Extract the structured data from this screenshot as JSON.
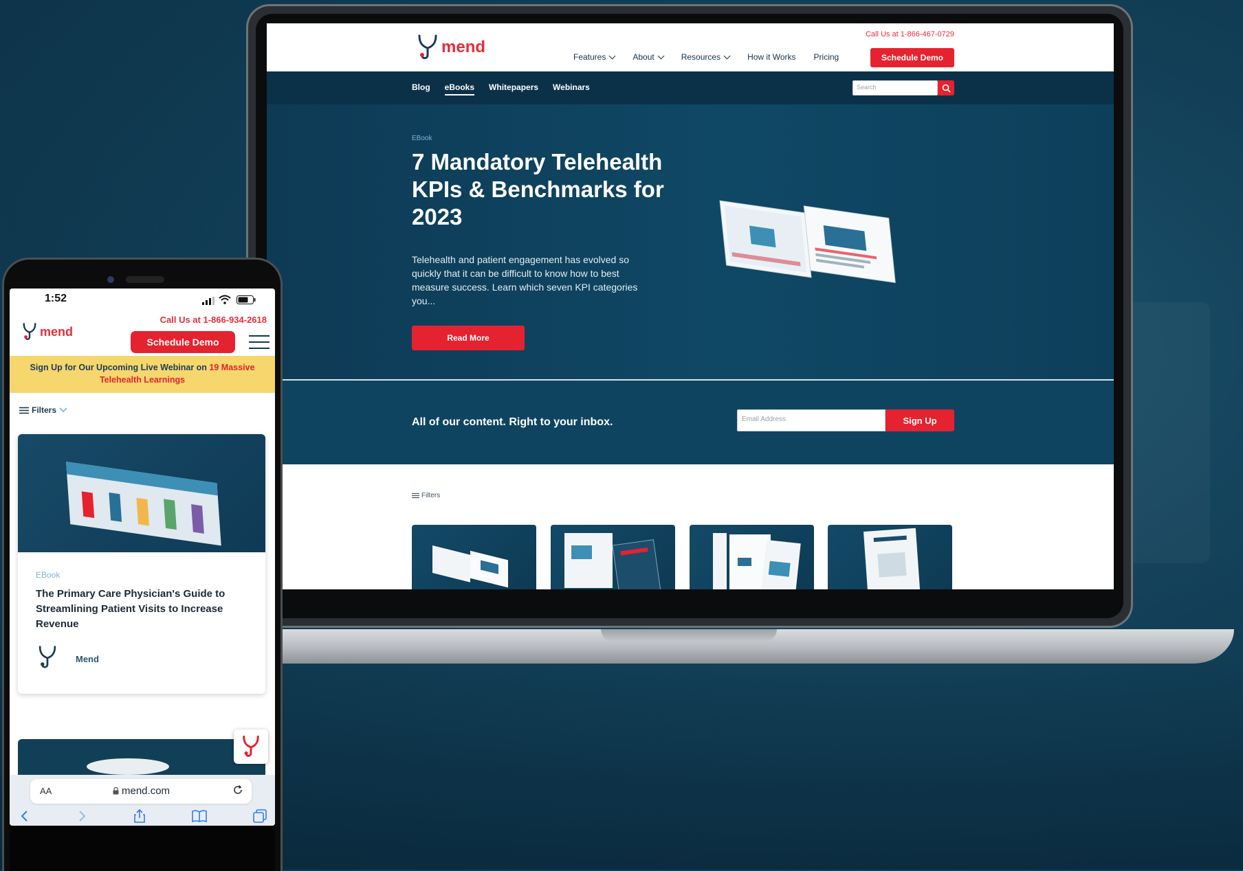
{
  "laptop": {
    "brand": "mend",
    "call_us": "Call Us at 1-866-467-0729",
    "nav": [
      {
        "label": "Features",
        "dropdown": true
      },
      {
        "label": "About",
        "dropdown": true
      },
      {
        "label": "Resources",
        "dropdown": true
      },
      {
        "label": "How it Works",
        "dropdown": false
      },
      {
        "label": "Pricing",
        "dropdown": false
      }
    ],
    "schedule_demo": "Schedule Demo",
    "subnav": [
      "Blog",
      "eBooks",
      "Whitepapers",
      "Webinars"
    ],
    "subnav_active": "eBooks",
    "search_placeholder": "Search",
    "hero": {
      "eyebrow": "EBook",
      "title": "7 Mandatory Telehealth KPIs & Benchmarks for 2023",
      "description": "Telehealth and patient engagement has evolved so quickly that it can be difficult to know how to best measure success. Learn which seven KPI categories you...",
      "cta": "Read More"
    },
    "signup": {
      "text": "All of our content. Right to your inbox.",
      "email_placeholder": "Email Address",
      "button": "Sign Up"
    },
    "filters_label": "Filters"
  },
  "phone": {
    "time": "1:52",
    "brand": "mend",
    "call_us": "Call Us at 1-866-934-2618",
    "schedule_demo": "Schedule Demo",
    "banner_text": "Sign Up for Our Upcoming Live Webinar on ",
    "banner_highlight": "19 Massive Telehealth Learnings",
    "filters_label": "Filters",
    "card": {
      "tag": "EBook",
      "title": "The Primary Care Physician's Guide to Streamlining Patient Visits to Increase Revenue",
      "author": "Mend"
    },
    "safari": {
      "aa": "AA",
      "url": "mend.com"
    }
  },
  "colors": {
    "brand_red": "#e5222f",
    "navy": "#0b3149",
    "hero_blue": "#0f4865",
    "banner_yellow": "#f5d76e"
  }
}
